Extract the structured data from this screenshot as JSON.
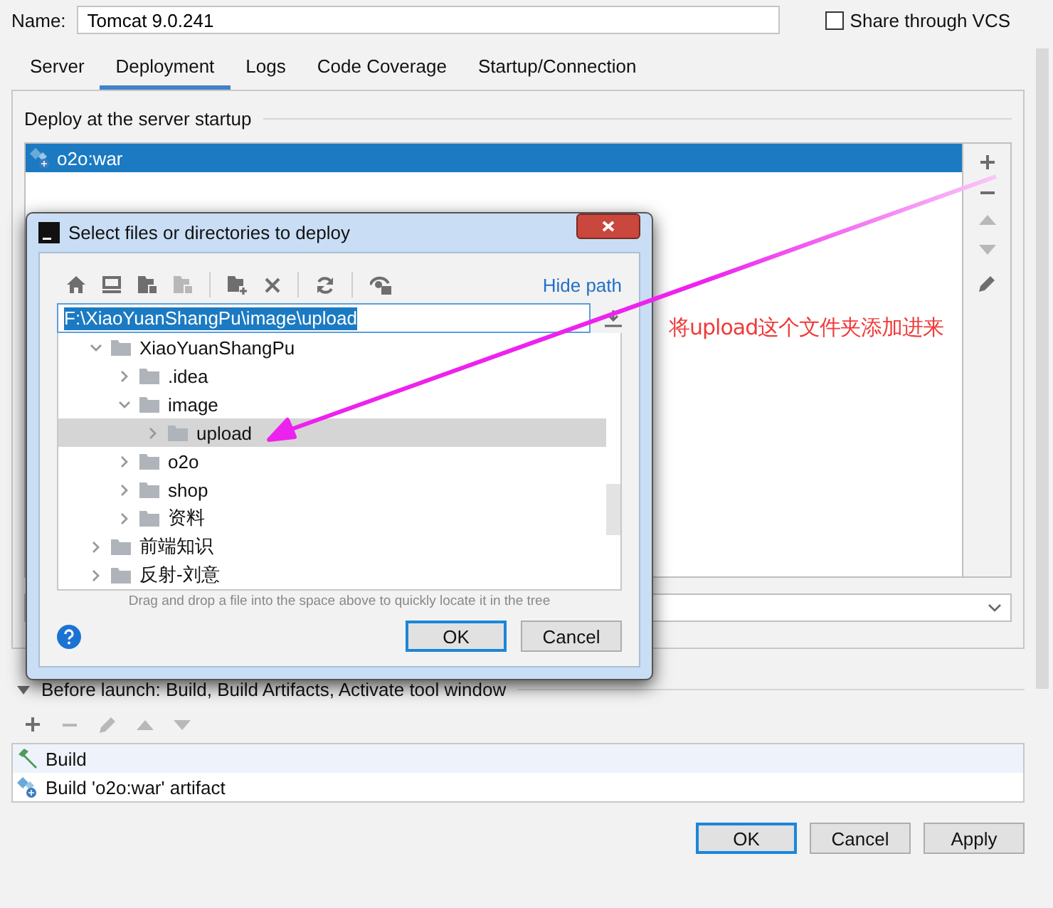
{
  "name_field": {
    "label": "Name:",
    "value": "Tomcat 9.0.241"
  },
  "share_vcs": {
    "label": "Share through VCS",
    "checked": false
  },
  "tabs": [
    {
      "label": "Server",
      "selected": false
    },
    {
      "label": "Deployment",
      "selected": true
    },
    {
      "label": "Logs",
      "selected": false
    },
    {
      "label": "Code Coverage",
      "selected": false
    },
    {
      "label": "Startup/Connection",
      "selected": false
    }
  ],
  "deploy": {
    "title": "Deploy at the server startup",
    "items": [
      {
        "label": "o2o:war",
        "selected": true
      }
    ],
    "toolbar": [
      {
        "kind": "add",
        "disabled": false
      },
      {
        "kind": "remove",
        "disabled": false
      },
      {
        "kind": "up",
        "disabled": true
      },
      {
        "kind": "down",
        "disabled": true
      },
      {
        "kind": "edit",
        "disabled": false
      }
    ]
  },
  "annotation": "将upload这个文件夹添加进来",
  "dialog": {
    "title": "Select files or directories to deploy",
    "toolbar": [
      {
        "kind": "home",
        "disabled": false
      },
      {
        "kind": "desktop",
        "disabled": false
      },
      {
        "kind": "module",
        "disabled": false
      },
      {
        "kind": "module",
        "disabled": true
      },
      {
        "kind": "sep"
      },
      {
        "kind": "newfolder",
        "disabled": false
      },
      {
        "kind": "delete",
        "disabled": false
      },
      {
        "kind": "sep"
      },
      {
        "kind": "refresh",
        "disabled": false
      },
      {
        "kind": "sep"
      },
      {
        "kind": "hidden",
        "disabled": false
      }
    ],
    "hide_path": "Hide path",
    "path": "F:\\XiaoYuanShangPu\\image\\upload",
    "tree": [
      {
        "label": "XiaoYuanShangPu",
        "expanded": true,
        "selected": false,
        "children": [
          {
            "label": ".idea",
            "expanded": false,
            "selected": false
          },
          {
            "label": "image",
            "expanded": true,
            "selected": false,
            "children": [
              {
                "label": "upload",
                "expanded": false,
                "selected": true
              }
            ]
          },
          {
            "label": "o2o",
            "expanded": false,
            "selected": false
          },
          {
            "label": "shop",
            "expanded": false,
            "selected": false
          },
          {
            "label": "资料",
            "expanded": false,
            "selected": false
          }
        ]
      },
      {
        "label": "前端知识",
        "expanded": false,
        "selected": false
      },
      {
        "label": "反射-刘意",
        "expanded": false,
        "selected": false
      }
    ],
    "hint": "Drag and drop a file into the space above to quickly locate it in the tree",
    "buttons": [
      {
        "label": "OK",
        "default": true
      },
      {
        "label": "Cancel",
        "default": false
      }
    ]
  },
  "before_launch": {
    "title": "Before launch: Build, Build Artifacts, Activate tool window",
    "expanded": true,
    "toolbar": [
      {
        "kind": "add",
        "disabled": false
      },
      {
        "kind": "remove",
        "disabled": true
      },
      {
        "kind": "edit",
        "disabled": true
      },
      {
        "kind": "up",
        "disabled": true
      },
      {
        "kind": "down",
        "disabled": true
      }
    ],
    "items": [
      {
        "kind": "build",
        "label": "Build",
        "selected": true
      },
      {
        "kind": "artifact",
        "label": "Build 'o2o:war' artifact",
        "selected": false
      }
    ]
  },
  "buttons": [
    {
      "label": "OK",
      "default": true
    },
    {
      "label": "Cancel",
      "default": false
    },
    {
      "label": "Apply",
      "default": false
    }
  ]
}
